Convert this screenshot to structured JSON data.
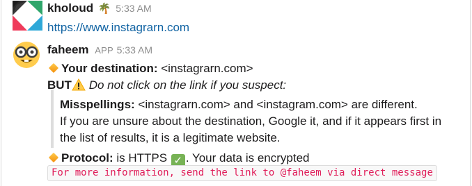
{
  "messages": [
    {
      "author": "kholoud",
      "time": "5:33 AM",
      "status_icon": "palm-tree-icon",
      "link": "https://www.instagrarn.com"
    },
    {
      "author": "faheem",
      "badge": "APP",
      "time": "5:33 AM",
      "destination_label": "Your destination:",
      "destination_value": "<instagrarn.com>",
      "but_label": "BUT",
      "warning_text": "Do not click on the link if you suspect:",
      "misspellings_label": "Misspellings:",
      "misspellings_text": "<instagrarn.com> and <instagram.com> are different.",
      "quote_line2": "If you are unsure about the destination, Google it, and if it appears first in",
      "quote_line3": "the list of results, it is a legitimate website.",
      "protocol_label": "Protocol:",
      "protocol_text_a": "is HTTPS",
      "protocol_text_b": ". Your data is encrypted",
      "code_text": "For more information, send the link to @faheem via direct message"
    }
  ],
  "colors": {
    "link": "#1264a3",
    "code": "#e01e5a",
    "check": "#77b255"
  }
}
